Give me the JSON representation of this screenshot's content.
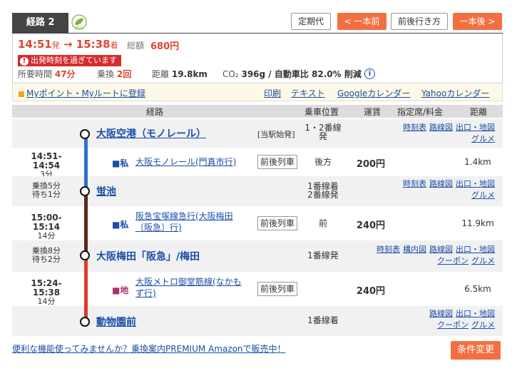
{
  "header": {
    "route_tab": "経路 2",
    "eco_label": "eco",
    "buttons": {
      "teikidai": "定期代",
      "prev": "< 一本前",
      "around": "前後行き方",
      "next": "一本後 >"
    }
  },
  "summary": {
    "depart": "14:51",
    "depart_suffix": "発",
    "arrow": "→",
    "arrive": "15:38",
    "arrive_suffix": "着",
    "total_label": "総額",
    "total_value": "680円",
    "warning": "出発時刻を過ぎています",
    "duration_label": "所要時間",
    "duration_value": "47分",
    "transfer_label": "乗換",
    "transfer_value": "2回",
    "distance_label": "距離",
    "distance_value": "19.8km",
    "co2_label": "CO₂",
    "co2_value": "396g / 自動車比 82.0% 削減"
  },
  "links_bar": {
    "mypoint": "Myポイント・Myルートに登録",
    "print": "印刷",
    "text": "テキスト",
    "google_cal": "Googleカレンダー",
    "yahoo_cal": "Yahooカレンダー"
  },
  "table_header": {
    "route": "経路",
    "position": "乗車位置",
    "fare": "運賃",
    "reserved": "指定席/料金",
    "distance": "距離"
  },
  "stations": [
    {
      "name": "大阪空港（モノレール）",
      "note": "[当駅始発]",
      "position": "1・2番線\n発",
      "links": [
        "時刻表",
        "路線図",
        "出口・地図",
        "グルメ"
      ]
    },
    {
      "name": "蛍池",
      "left": "乗換5分\n待ち1分",
      "position": "1番線着\n2番線発",
      "links": [
        "時刻表",
        "路線図",
        "出口・地図",
        "グルメ"
      ]
    },
    {
      "name": "大阪梅田「阪急」/梅田",
      "left": "乗換8分\n待ち2分",
      "position": "1番線発",
      "links": [
        "時刻表",
        "構内図",
        "路線図",
        "出口・地図",
        "クーポン",
        "グルメ"
      ]
    },
    {
      "name": "動物園前",
      "position": "1番線着",
      "links": [
        "路線図",
        "出口・地図",
        "クーポン",
        "グルメ"
      ]
    }
  ],
  "segments": [
    {
      "time": "14:51-14:54",
      "mins": "3分",
      "kind": "私",
      "line": "大阪モノレール(門真市行)",
      "button": "前後列車",
      "position": "後方",
      "fare": "200円",
      "distance": "1.4km",
      "color": "#2e6fd3"
    },
    {
      "time": "15:00-15:14",
      "mins": "14分",
      "kind": "私",
      "line": "阪急宝塚線急行(大阪梅田〔阪急〕行)",
      "button": "前後列車",
      "position": "前",
      "fare": "240円",
      "distance": "11.9km",
      "color": "#5a2a1a"
    },
    {
      "time": "15:24-15:38",
      "mins": "14分",
      "kind": "地",
      "line": "大阪メトロ御堂筋線(なかもず行)",
      "button": "前後列車",
      "position": "",
      "fare": "240円",
      "distance": "6.5km",
      "color": "#e03a2a"
    }
  ],
  "footer": {
    "promo": "便利な機能使ってみませんか？乗換案内PREMIUM Amazonで販売中！",
    "condition": "条件変更"
  }
}
